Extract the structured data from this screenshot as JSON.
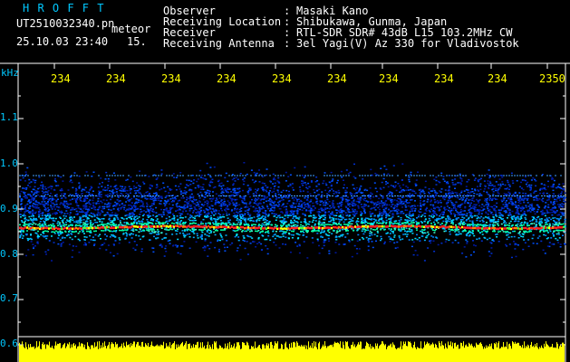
{
  "header": {
    "program": "H R O F F T",
    "filename": "UT2510032340.pn",
    "tag": "meteor",
    "datetime": "25.10.03 23:40",
    "counter": "15.",
    "fields": [
      {
        "label": "Observer",
        "sep": ":",
        "value": "Masaki Kano"
      },
      {
        "label": "Receiving Location",
        "sep": ":",
        "value": "Shibukawa, Gunma, Japan"
      },
      {
        "label": "Receiver",
        "sep": ":",
        "value": "RTL-SDR SDR# 43dB L15 103.2MHz CW"
      },
      {
        "label": "Receiving Antenna",
        "sep": ":",
        "value": "3el Yagi(V) Az 330 for Vladivostok"
      }
    ]
  },
  "axes": {
    "y_unit": "kHz",
    "y_ticks": [
      "1.1",
      "1.0",
      "0.9",
      "0.8",
      "0.7",
      "0.6"
    ],
    "time_ticks": [
      "234",
      "234",
      "234",
      "234",
      "234",
      "234",
      "234",
      "234",
      "234",
      "2350"
    ]
  },
  "colors": {
    "label_cyan": "#00c8ff",
    "tick_yellow": "#ffff00",
    "echo_line": "#ff2020",
    "noise_blue": "#0030c0",
    "signal_bar": "#ffff00"
  },
  "chart_data": {
    "type": "heatmap",
    "y_unit": "kHz",
    "ylim": [
      0.6,
      1.15
    ],
    "noise_band_khz": [
      0.78,
      1.01
    ],
    "carrier_line_khz": 0.86,
    "faint_lines_khz": [
      0.975,
      0.93
    ]
  }
}
